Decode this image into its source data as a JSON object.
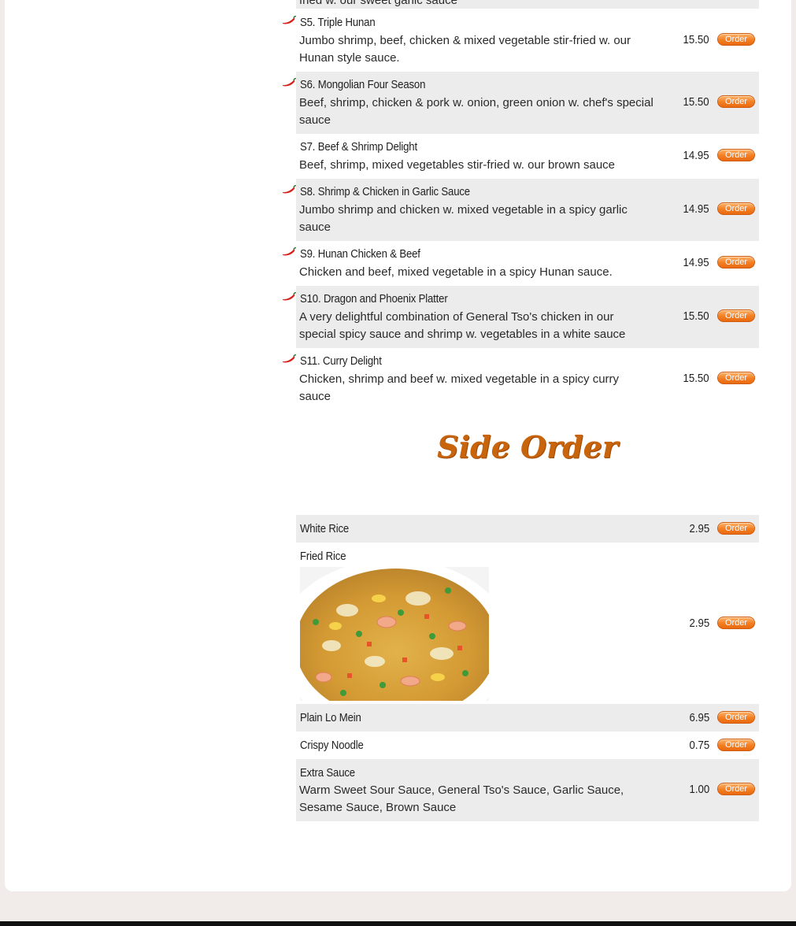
{
  "top_cutoff_desc": "fried w. our sweet garlic sauce",
  "order_label": "Order",
  "specials": [
    {
      "name": "S5. Triple Hunan",
      "desc": "Jumbo shrimp, beef, chicken & mixed vegetable stir-fried w. our Hunan style sauce.",
      "price": "15.50",
      "spicy": true
    },
    {
      "name": "S6. Mongolian Four Season",
      "desc": "Beef, shrimp, chicken & pork w. onion, green onion w. chef's special sauce",
      "price": "15.50",
      "spicy": true
    },
    {
      "name": "S7. Beef & Shrimp Delight",
      "desc": "Beef, shrimp, mixed vegetables stir-fried w. our brown sauce",
      "price": "14.95",
      "spicy": false
    },
    {
      "name": "S8. Shrimp & Chicken in Garlic Sauce",
      "desc": "Jumbo shrimp and chicken w. mixed vegetable in a spicy garlic sauce",
      "price": "14.95",
      "spicy": true
    },
    {
      "name": "S9. Hunan Chicken & Beef",
      "desc": "Chicken and beef, mixed vegetable in a spicy Hunan sauce.",
      "price": "14.95",
      "spicy": true
    },
    {
      "name": "S10. Dragon and Phoenix Platter",
      "desc": "A very delightful combination of General Tso's chicken in our special spicy sauce and shrimp w. vegetables in a white sauce",
      "price": "15.50",
      "spicy": true
    },
    {
      "name": "S11. Curry Delight",
      "desc": "Chicken, shrimp and beef w. mixed vegetable in a spicy curry sauce",
      "price": "15.50",
      "spicy": true
    }
  ],
  "side_order_title": "Side Order",
  "sides": [
    {
      "name": "White Rice",
      "price": "2.95"
    },
    {
      "name": "Fried Rice",
      "price": "2.95"
    },
    {
      "name": "Plain Lo Mein",
      "price": "6.95"
    },
    {
      "name": "Crispy Noodle",
      "price": "0.75"
    },
    {
      "name": "Extra Sauce",
      "desc": "Warm Sweet Sour Sauce, General Tso's Sauce, Garlic Sauce, Sesame Sauce, Brown Sauce",
      "price": "1.00"
    }
  ],
  "colors": {
    "accent": "#f47e22",
    "row_shade": "#ececec",
    "title": "#c8640c"
  }
}
